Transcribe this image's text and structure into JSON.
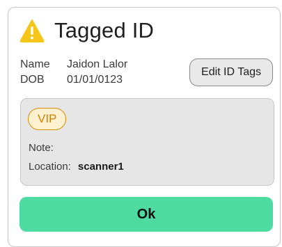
{
  "dialog": {
    "title": "Tagged ID",
    "icon": "warning-icon",
    "warning_color": "#f5c518"
  },
  "person": {
    "name_label": "Name",
    "name_value": "Jaidon Lalor",
    "dob_label": "DOB",
    "dob_value": "01/01/0123"
  },
  "actions": {
    "edit_tags_label": "Edit ID Tags",
    "ok_label": "Ok",
    "ok_color": "#4edba1"
  },
  "tag_panel": {
    "tag_label": "VIP",
    "note_label": "Note:",
    "location_label": "Location:",
    "location_value": "scanner1"
  }
}
